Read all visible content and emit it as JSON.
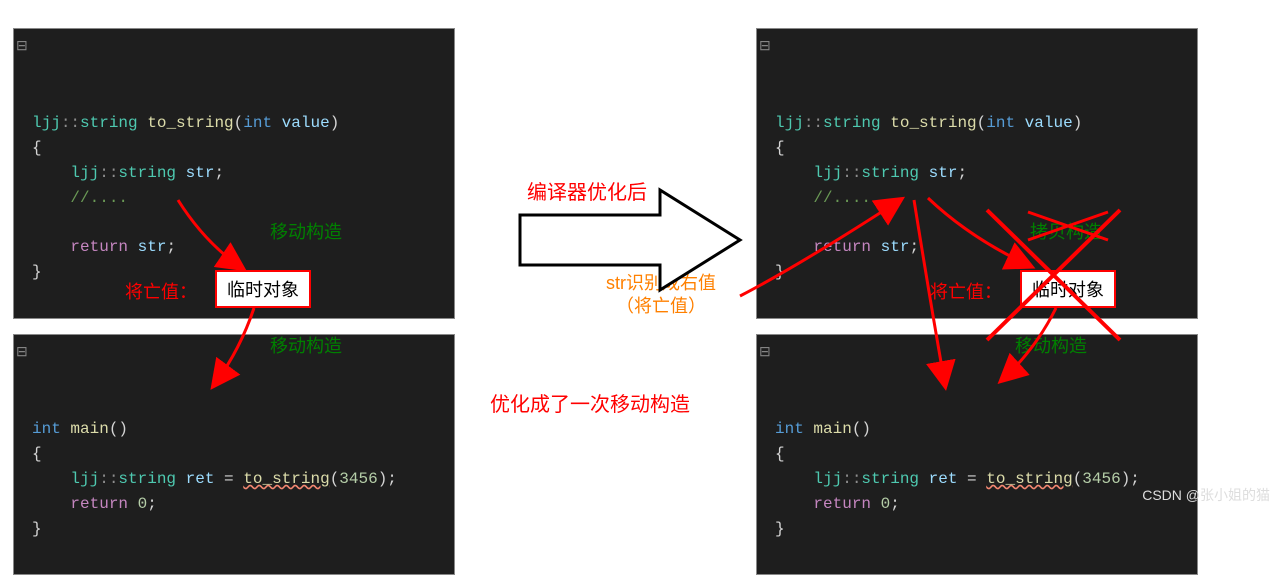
{
  "left": {
    "code1": {
      "lines": [
        {
          "tokens": [
            {
              "t": "ljj",
              "c": "k-type"
            },
            {
              "t": "::",
              "c": "k-ns"
            },
            {
              "t": "string ",
              "c": "k-type"
            },
            {
              "t": "to_string",
              "c": "k-func"
            },
            {
              "t": "(",
              "c": "k-punc"
            },
            {
              "t": "int ",
              "c": "k-key"
            },
            {
              "t": "value",
              "c": "k-var"
            },
            {
              "t": ")",
              "c": "k-punc"
            }
          ]
        },
        {
          "tokens": [
            {
              "t": "{",
              "c": "k-punc"
            }
          ]
        },
        {
          "tokens": [
            {
              "t": "    ljj",
              "c": "k-type"
            },
            {
              "t": "::",
              "c": "k-ns"
            },
            {
              "t": "string ",
              "c": "k-type"
            },
            {
              "t": "str",
              "c": "k-var"
            },
            {
              "t": ";",
              "c": "k-punc"
            }
          ]
        },
        {
          "tokens": [
            {
              "t": "    //....",
              "c": "k-cmt"
            }
          ]
        },
        {
          "tokens": [
            {
              "t": "",
              "c": ""
            }
          ]
        },
        {
          "tokens": [
            {
              "t": "    ",
              "c": ""
            },
            {
              "t": "return ",
              "c": "k-flow"
            },
            {
              "t": "str",
              "c": "k-var"
            },
            {
              "t": ";",
              "c": "k-punc"
            }
          ]
        },
        {
          "tokens": [
            {
              "t": "}",
              "c": "k-punc"
            }
          ]
        }
      ]
    },
    "code2": {
      "lines": [
        {
          "tokens": [
            {
              "t": "int ",
              "c": "k-key"
            },
            {
              "t": "main",
              "c": "k-func"
            },
            {
              "t": "()",
              "c": "k-punc"
            }
          ]
        },
        {
          "tokens": [
            {
              "t": "{",
              "c": "k-punc"
            }
          ]
        },
        {
          "tokens": [
            {
              "t": "    ljj",
              "c": "k-type"
            },
            {
              "t": "::",
              "c": "k-ns"
            },
            {
              "t": "string ",
              "c": "k-type"
            },
            {
              "t": "ret",
              "c": "k-var"
            },
            {
              "t": " = ",
              "c": "k-punc"
            },
            {
              "t": "to_string",
              "c": "k-func",
              "sq": true
            },
            {
              "t": "(",
              "c": "k-punc"
            },
            {
              "t": "3456",
              "c": "k-num"
            },
            {
              "t": ");",
              "c": "k-punc"
            }
          ]
        },
        {
          "tokens": [
            {
              "t": "    ",
              "c": ""
            },
            {
              "t": "return ",
              "c": "k-flow"
            },
            {
              "t": "0",
              "c": "k-num"
            },
            {
              "t": ";",
              "c": "k-punc"
            }
          ]
        },
        {
          "tokens": [
            {
              "t": "}",
              "c": "k-punc"
            }
          ]
        }
      ]
    },
    "dying_label": "将亡值：",
    "tempobj_label": "临时对象",
    "moveconstr1": "移动构造",
    "moveconstr2": "移动构造"
  },
  "right": {
    "code1": {
      "lines": [
        {
          "tokens": [
            {
              "t": "ljj",
              "c": "k-type"
            },
            {
              "t": "::",
              "c": "k-ns"
            },
            {
              "t": "string ",
              "c": "k-type"
            },
            {
              "t": "to_string",
              "c": "k-func"
            },
            {
              "t": "(",
              "c": "k-punc"
            },
            {
              "t": "int ",
              "c": "k-key"
            },
            {
              "t": "value",
              "c": "k-var"
            },
            {
              "t": ")",
              "c": "k-punc"
            }
          ]
        },
        {
          "tokens": [
            {
              "t": "{",
              "c": "k-punc"
            }
          ]
        },
        {
          "tokens": [
            {
              "t": "    ljj",
              "c": "k-type"
            },
            {
              "t": "::",
              "c": "k-ns"
            },
            {
              "t": "string ",
              "c": "k-type"
            },
            {
              "t": "str",
              "c": "k-var"
            },
            {
              "t": ";",
              "c": "k-punc"
            }
          ]
        },
        {
          "tokens": [
            {
              "t": "    //....",
              "c": "k-cmt"
            }
          ]
        },
        {
          "tokens": [
            {
              "t": "",
              "c": ""
            }
          ]
        },
        {
          "tokens": [
            {
              "t": "    ",
              "c": ""
            },
            {
              "t": "return ",
              "c": "k-flow"
            },
            {
              "t": "str",
              "c": "k-var"
            },
            {
              "t": ";",
              "c": "k-punc"
            }
          ]
        },
        {
          "tokens": [
            {
              "t": "}",
              "c": "k-punc"
            }
          ]
        }
      ]
    },
    "code2": {
      "lines": [
        {
          "tokens": [
            {
              "t": "int ",
              "c": "k-key"
            },
            {
              "t": "main",
              "c": "k-func"
            },
            {
              "t": "()",
              "c": "k-punc"
            }
          ]
        },
        {
          "tokens": [
            {
              "t": "{",
              "c": "k-punc"
            }
          ]
        },
        {
          "tokens": [
            {
              "t": "    ljj",
              "c": "k-type"
            },
            {
              "t": "::",
              "c": "k-ns"
            },
            {
              "t": "string ",
              "c": "k-type"
            },
            {
              "t": "ret",
              "c": "k-var"
            },
            {
              "t": " = ",
              "c": "k-punc"
            },
            {
              "t": "to_string",
              "c": "k-func",
              "sq": true
            },
            {
              "t": "(",
              "c": "k-punc"
            },
            {
              "t": "3456",
              "c": "k-num"
            },
            {
              "t": ");",
              "c": "k-punc"
            }
          ]
        },
        {
          "tokens": [
            {
              "t": "    ",
              "c": ""
            },
            {
              "t": "return ",
              "c": "k-flow"
            },
            {
              "t": "0",
              "c": "k-num"
            },
            {
              "t": ";",
              "c": "k-punc"
            }
          ]
        },
        {
          "tokens": [
            {
              "t": "}",
              "c": "k-punc"
            }
          ]
        }
      ]
    },
    "dying_label": "将亡值：",
    "tempobj_label": "临时对象",
    "copyconstr": "拷贝构造",
    "moveconstr": "移动构造",
    "str_rvalue_l1": "str识别成右值",
    "str_rvalue_l2": "（将亡值）"
  },
  "center": {
    "optimize_label": "编译器优化后",
    "result_label": "优化成了一次移动构造"
  },
  "watermark": "CSDN @张小姐的猫"
}
